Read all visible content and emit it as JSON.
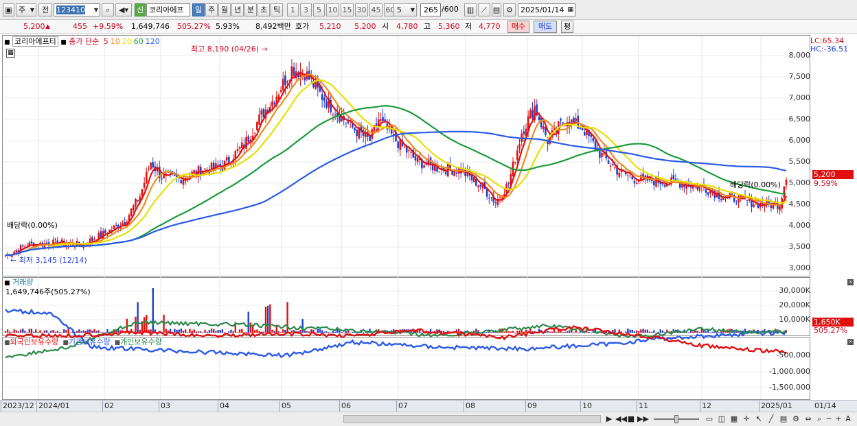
{
  "toolbar": {
    "market": "주",
    "prev_label": "전",
    "code": "123410",
    "new_badge": "신",
    "stock_name": "코리아에프",
    "periods": [
      "일",
      "주",
      "월",
      "년",
      "분",
      "초",
      "틱"
    ],
    "active_period": "일",
    "intervals": [
      "1",
      "3",
      "5",
      "10",
      "15",
      "30",
      "45",
      "60"
    ],
    "interval_select": "5",
    "count": "265",
    "count_total": "/600",
    "date": "2025/01/14"
  },
  "quote": {
    "price": "5,200",
    "change_arrow": "▲",
    "change": "455",
    "change_pct": "+9.59%",
    "volume": "1,649,746",
    "volume_ratio": "505.27%",
    "turnover": "5.93%",
    "amount": "8,492백만",
    "ask_label": "호가",
    "ask1": "5,210",
    "ask2": "5,200",
    "open_label": "시",
    "open": "4,780",
    "high_label": "고",
    "high": "5,360",
    "low_label": "저",
    "low": "4,770",
    "buy_label": "매수",
    "sell_label": "매도",
    "eval_label": "평"
  },
  "price_panel": {
    "stock_name": "코리아에프티",
    "legend_prefix": "종가 단순",
    "ma": [
      {
        "label": "5",
        "color": "#e01010"
      },
      {
        "label": "10",
        "color": "#f08a1a"
      },
      {
        "label": "20",
        "color": "#e8e000"
      },
      {
        "label": "60",
        "color": "#1a9a3a"
      },
      {
        "label": "120",
        "color": "#2a5ae8"
      }
    ],
    "lc": "LC:65.34",
    "hc": "HC:-36.51",
    "high_note": "최고 8,190 (04/26)",
    "low_note": "최저 3,145 (12/14)",
    "div_note_left": "배당락(0.00%)",
    "div_note_right": "배당락(0.00%)",
    "axis": [
      "8,000",
      "7,500",
      "7,000",
      "6,500",
      "6,000",
      "5,500",
      "5,000",
      "4,500",
      "4,000",
      "3,500",
      "3,000"
    ],
    "price_tag": "5,200",
    "pct_tag": "9.59%"
  },
  "volume_panel": {
    "title": "거래량",
    "value": "1,649,746주(505.27%)",
    "axis": [
      "30,000K",
      "20,000K",
      "10,000K"
    ],
    "tag": "1,650K",
    "pct_tag": "505.27%"
  },
  "holding_panel": {
    "series": [
      {
        "name": "외국인보유수량",
        "color": "#e01010"
      },
      {
        "name": "기관보유수량",
        "color": "#2a5ae8"
      },
      {
        "name": "개인보유수량",
        "color": "#2a8a4a"
      }
    ],
    "axis": [
      "-500,000",
      "-1,000,000",
      "-1,500,000"
    ]
  },
  "dates": [
    "2023/12",
    "2024/01",
    "02",
    "03",
    "04",
    "05",
    "06",
    "07",
    "08",
    "09",
    "10",
    "11",
    "12",
    "2025/01",
    "01/14"
  ],
  "colors": {
    "up": "#d0021b",
    "down": "#1f3fd0",
    "accent": "#3a6fb0"
  }
}
